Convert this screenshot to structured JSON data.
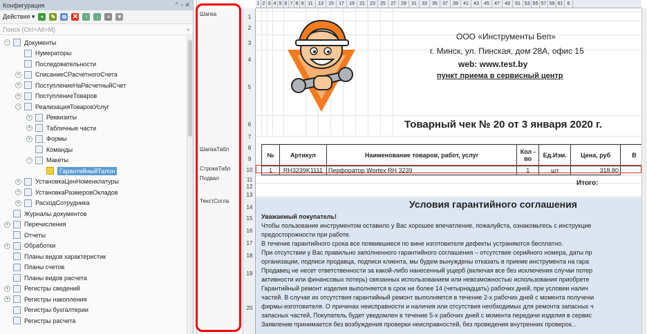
{
  "window": {
    "title": "Конфигурация",
    "title_buttons": "⌃ ▫ ✕"
  },
  "toolbar": {
    "actions_label": "Действия ▾"
  },
  "search": {
    "placeholder": "Поиск (Ctrl+Alt+M)",
    "clear": "×"
  },
  "tree": [
    {
      "label": "Документы",
      "indent": 0,
      "exp": "⊟"
    },
    {
      "label": "Нумераторы",
      "indent": 2,
      "exp": ""
    },
    {
      "label": "Последовательности",
      "indent": 2,
      "exp": ""
    },
    {
      "label": "СписаниеСРасчетногоСчета",
      "indent": 2,
      "exp": "⊕"
    },
    {
      "label": "ПоступлениеНаРасчетныйСчет",
      "indent": 2,
      "exp": "⊕"
    },
    {
      "label": "ПоступлениеТоваров",
      "indent": 2,
      "exp": "⊕"
    },
    {
      "label": "РеализацияТоваровУслуг",
      "indent": 2,
      "exp": "⊟"
    },
    {
      "label": "Реквизиты",
      "indent": 4,
      "exp": "⊕"
    },
    {
      "label": "Табличные части",
      "indent": 4,
      "exp": "⊕"
    },
    {
      "label": "Формы",
      "indent": 4,
      "exp": "⊕"
    },
    {
      "label": "Команды",
      "indent": 4,
      "exp": ""
    },
    {
      "label": "Макеты",
      "indent": 4,
      "exp": "⊟"
    },
    {
      "label": "ГарантийныйТалон",
      "indent": 6,
      "exp": "",
      "selected": true
    },
    {
      "label": "УстановкаЦенНоменклатуры",
      "indent": 2,
      "exp": "⊕"
    },
    {
      "label": "УстановкаРазмеровОкладов",
      "indent": 2,
      "exp": "⊕"
    },
    {
      "label": "РасходСотрудника",
      "indent": 2,
      "exp": "⊕"
    },
    {
      "label": "Журналы документов",
      "indent": 0,
      "exp": ""
    },
    {
      "label": "Перечисления",
      "indent": 0,
      "exp": "⊕"
    },
    {
      "label": "Отчеты",
      "indent": 0,
      "exp": ""
    },
    {
      "label": "Обработки",
      "indent": 0,
      "exp": "⊕"
    },
    {
      "label": "Планы видов характеристик",
      "indent": 0,
      "exp": ""
    },
    {
      "label": "Планы счетов",
      "indent": 0,
      "exp": ""
    },
    {
      "label": "Планы видов расчета",
      "indent": 0,
      "exp": ""
    },
    {
      "label": "Регистры сведений",
      "indent": 0,
      "exp": "⊕"
    },
    {
      "label": "Регистры накопления",
      "indent": 0,
      "exp": "⊕"
    },
    {
      "label": "Регистры бухгалтерии",
      "indent": 0,
      "exp": ""
    },
    {
      "label": "Регистры расчета",
      "indent": 0,
      "exp": ""
    }
  ],
  "sheet": {
    "col_headers": [
      "1",
      "2",
      "3",
      "4",
      "5",
      "6",
      "7",
      "8",
      "9",
      "11",
      "13",
      "15",
      "17",
      "19",
      "21",
      "23",
      "25",
      "27",
      "29",
      "31",
      "33",
      "35",
      "37",
      "39",
      "41",
      "43",
      "45",
      "47",
      "49",
      "51",
      "53",
      "55",
      "57",
      "59",
      "61",
      "6"
    ],
    "sections": [
      "Шапка",
      "ШапкаТабл",
      "СтрокаТабл",
      "Подвал",
      "ТекстСогла"
    ],
    "row_numbers": [
      "1",
      "2",
      "3",
      "4",
      "5",
      "6",
      "7",
      "8",
      "9",
      "10",
      "11",
      "12",
      "13",
      "14",
      "15",
      "16",
      "17",
      "18",
      "19",
      "20"
    ],
    "company": "ООО «Инструменты Беп»",
    "address": "г. Минск, ул. Пинская, дом 28А, офис 15",
    "web": "web: www.test.by",
    "service": "пункт приема в сервисный центр",
    "receipt_title": "Товарный чек № 20 от 3 января 2020 г.",
    "table_headers": [
      "№",
      "Артикул",
      "Наименование товаров, работ, услуг",
      "Кол - во",
      "Ед.Изм.",
      "Цена, руб",
      "В"
    ],
    "table_row": [
      "1",
      "RH3239K1111",
      "Перфоратор Wortex RH 3239",
      "1",
      "шт",
      "318,80",
      ""
    ],
    "total_label": "Итого:",
    "terms_title": "Условия гарантийного соглашения",
    "terms_lines": [
      "Уважаемый покупатель!",
      "Чтобы пользование инструментом оставило у Вас хорошее впечатление, пожалуйста, ознакомьтесь с инструкцие",
      "предосторожности при работе.",
      "В течение гарантийного срока все появившиеся по вине изготовителя дефекты устраняются бесплатно.",
      "При отсутствии у Вас правильно заполненного гарантийного соглашения – отсутствие серийного номера, даты пр",
      "организации, подписи продавца, подписи клиента, мы будем вынуждены отказать в приеме инструмента на гара",
      "Продавец не несет ответственности за какой-либо нанесенный ущерб (включая все без исключения случаи потер",
      "активности или финансовых потерь) связанных использованием или невозможностью использования приобрете",
      "Гарантийный ремонт изделия выполняется в срок не более  14 (четырнадцать) рабочих дней, при условии налич",
      "частей. В случае их отсутствия гарантийный ремонт выполняется в течение 2-х рабочих дней с момента получени",
      "фирмы-изготовителя. О причинах неисправности и наличия или отсутствия необходимых для ремонта запасных ч",
      "запасных частей, Покупатель будет уведомлен в течение 5-х рабочих дней с момента передачи изделия в сервис",
      "Заявление принимается без возбуждения проверки неисправностей, без проведения внутренних проверок..."
    ]
  }
}
